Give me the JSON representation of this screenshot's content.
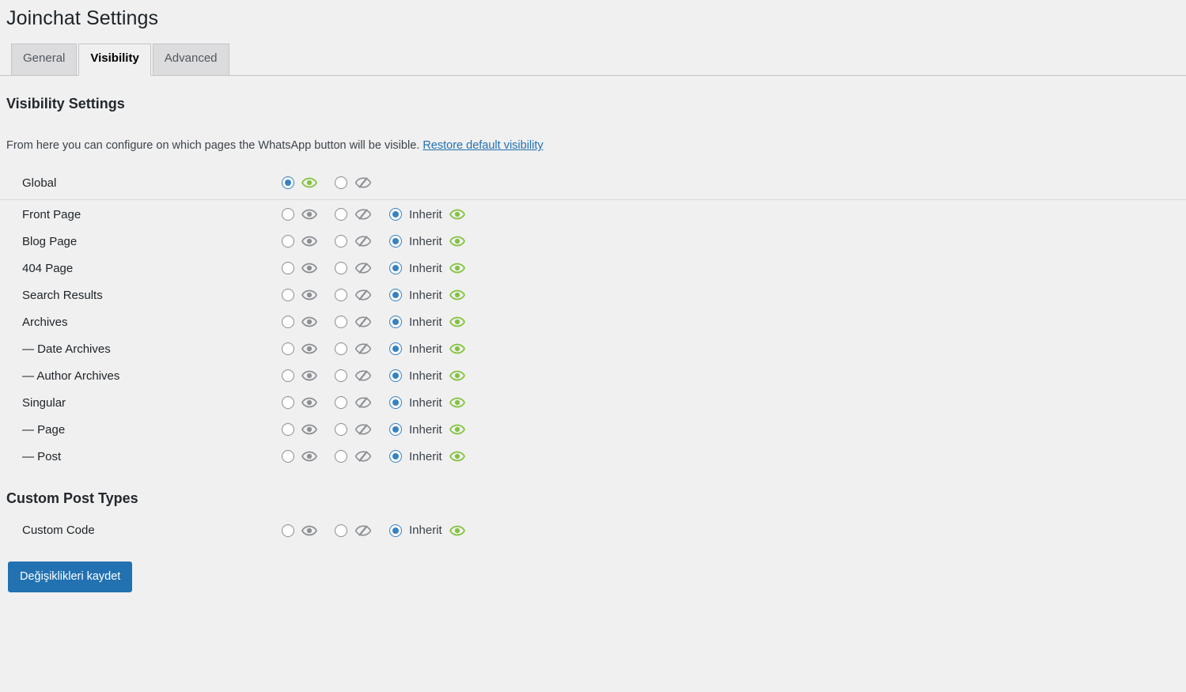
{
  "page": {
    "title": "Joinchat Settings"
  },
  "tabs": [
    {
      "label": "General",
      "active": false
    },
    {
      "label": "Visibility",
      "active": true
    },
    {
      "label": "Advanced",
      "active": false
    }
  ],
  "section": {
    "heading": "Visibility Settings",
    "description": "From here you can configure on which pages the WhatsApp button will be visible.",
    "restore_link": "Restore default visibility"
  },
  "labels": {
    "inherit": "Inherit",
    "show_icon": "eye-icon",
    "hide_icon": "eye-slash-icon",
    "inherit_icon": "eye-icon-green"
  },
  "colors": {
    "page_background": "#f0f0f1",
    "radio_checked": "#3582c4",
    "eye_active_green": "#83c33d",
    "eye_inactive_gray": "#8c8f94",
    "link": "#2271b1",
    "primary_button": "#2271b1",
    "tab_inactive_bg": "#dcdcde",
    "border": "#c3c4c7"
  },
  "global_row": {
    "label": "Global",
    "selected": "show"
  },
  "rows": [
    {
      "label": "Front Page",
      "selected": "inherit",
      "child": false
    },
    {
      "label": "Blog Page",
      "selected": "inherit",
      "child": false
    },
    {
      "label": "404 Page",
      "selected": "inherit",
      "child": false
    },
    {
      "label": "Search Results",
      "selected": "inherit",
      "child": false
    },
    {
      "label": "Archives",
      "selected": "inherit",
      "child": false
    },
    {
      "label": "— Date Archives",
      "selected": "inherit",
      "child": true
    },
    {
      "label": "— Author Archives",
      "selected": "inherit",
      "child": true
    },
    {
      "label": "Singular",
      "selected": "inherit",
      "child": false
    },
    {
      "label": "— Page",
      "selected": "inherit",
      "child": true
    },
    {
      "label": "— Post",
      "selected": "inherit",
      "child": true
    }
  ],
  "custom_post_types": {
    "heading": "Custom Post Types",
    "rows": [
      {
        "label": "Custom Code",
        "selected": "inherit",
        "child": false
      }
    ]
  },
  "submit": {
    "label": "Değişiklikleri kaydet"
  }
}
